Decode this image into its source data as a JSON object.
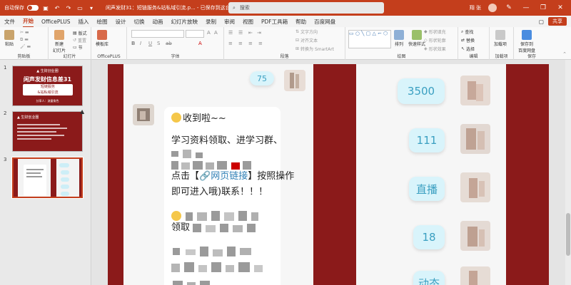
{
  "titlebar": {
    "autosave_label": "自动保存",
    "doc_title": "闲声发财31：短链服务&站私域引流.p... - 已保存到这台电脑",
    "search_placeholder": "搜索",
    "user_name": "翔 张",
    "accent": "#c43e1c"
  },
  "tabs": [
    {
      "label": "文件"
    },
    {
      "label": "开始"
    },
    {
      "label": "OfficePLUS"
    },
    {
      "label": "插入"
    },
    {
      "label": "绘图"
    },
    {
      "label": "设计"
    },
    {
      "label": "切换"
    },
    {
      "label": "动画"
    },
    {
      "label": "幻灯片放映"
    },
    {
      "label": "录制"
    },
    {
      "label": "审阅"
    },
    {
      "label": "视图"
    },
    {
      "label": "PDF工具箱"
    },
    {
      "label": "帮助"
    },
    {
      "label": "百度网盘"
    }
  ],
  "share_label": "共享",
  "ribbon": {
    "paste": "粘贴",
    "clipboard_label": "剪贴板",
    "new_slide": "新建\n幻灯片",
    "reuse": "重用\n幻灯片",
    "slides_label": "幻灯片",
    "layout": "版式",
    "reset": "重置",
    "section": "节",
    "template": "模板库",
    "officeplus_label": "OfficePLUS",
    "font_label": "字体",
    "paragraph_label": "段落",
    "text_direction": "文字方向",
    "align_text": "对齐文本",
    "smartart": "转换为 SmartArt",
    "drawing_label": "绘图",
    "arrange": "排列",
    "quick_styles": "快速样式",
    "shape_fill": "形状填充",
    "shape_outline": "形状轮廓",
    "shape_effect": "形状效果",
    "find": "查找",
    "replace": "替换",
    "select": "选择",
    "edit_label": "编辑",
    "addin": "加载项",
    "addin_label": "加载项",
    "save_baidu": "保存到\n百度网盘",
    "save_label": "保存"
  },
  "thumbnails": [
    {
      "num": "1",
      "head": "▲ 生财创业圈",
      "title": "闲声发财信息差31",
      "box": "短链服务\n&站私域引流",
      "foot": "分享人：流量角色"
    },
    {
      "num": "2",
      "head": "▲ 生财创业圈"
    },
    {
      "num": "3"
    }
  ],
  "slide": {
    "left_bubble": "75",
    "chat_lines": [
      "收到啦~~",
      "学习资料领取、进学习群、",
      "点击【",
      "网页链接",
      "】按照操作",
      "即可进入哦)联系！！！",
      "领取"
    ],
    "right_bubbles": [
      "3500",
      "111",
      "直播",
      "18",
      "动态"
    ]
  }
}
